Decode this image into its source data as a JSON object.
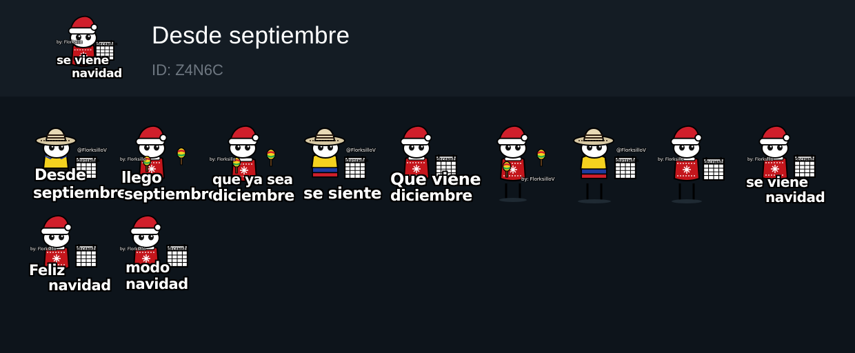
{
  "pack": {
    "title": "Desde septiembre",
    "id_label": "ID: Z4N6C",
    "icon": "santa-hat-character-calendar-icon",
    "icon_caption": [
      "se viene",
      "navidad"
    ]
  },
  "watermarks": {
    "short": "by: Florksillo",
    "handle": "@FlorksilloV",
    "long": "by: FlorksilloV"
  },
  "calendar": {
    "september": "SEPTEMBER",
    "december": "DECEMBER"
  },
  "colors": {
    "background": "#0d141b",
    "header": "#141c24",
    "id_text": "#6e7781",
    "santa_red": "#d01f2b",
    "sweater_red": "#c4161c",
    "jersey_yellow": "#f5d21f",
    "flag_blue": "#1f3b9c"
  },
  "stickers": [
    {
      "outfit": "sombrero-yellow-jersey",
      "caption": [
        "Desde",
        "septiembre"
      ]
    },
    {
      "outfit": "santa-hat-sweater-maracas",
      "caption": [
        "llego",
        "septiembre"
      ]
    },
    {
      "outfit": "santa-hat-sweater-maracas",
      "caption": [
        "que ya sea",
        "diciembre"
      ]
    },
    {
      "outfit": "sombrero-colombia-jersey",
      "caption": [
        "se siente"
      ]
    },
    {
      "outfit": "santa-hat-sweater-calendar",
      "caption": [
        "Que viene",
        "diciembre"
      ]
    },
    {
      "outfit": "santa-hat-sweater-maracas",
      "caption": []
    },
    {
      "outfit": "sombrero-colombia-jersey-calendar",
      "caption": []
    },
    {
      "outfit": "santa-hat-sweater-calendar",
      "caption": []
    },
    {
      "outfit": "santa-hat-sweater-calendar",
      "caption": [
        "se viene",
        "navidad"
      ]
    },
    {
      "outfit": "santa-hat-sweater-calendar",
      "caption": [
        "Feliz",
        "navidad"
      ]
    },
    {
      "outfit": "santa-hat-sweater-calendar",
      "caption": [
        "modo",
        "navidad"
      ]
    }
  ]
}
